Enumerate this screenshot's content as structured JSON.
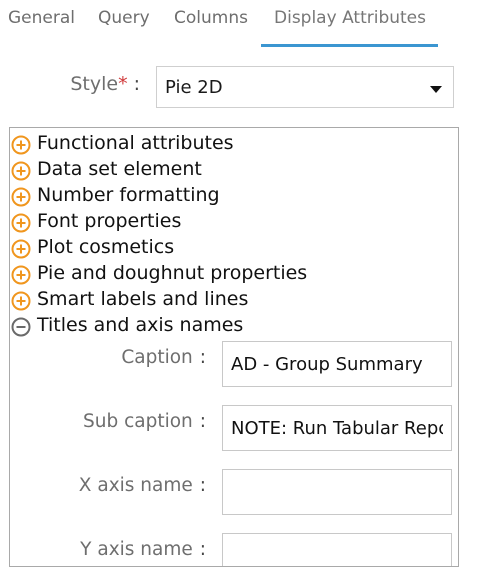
{
  "tabs": [
    {
      "label": "General"
    },
    {
      "label": "Query"
    },
    {
      "label": "Columns"
    },
    {
      "label": "Display Attributes",
      "active": true
    }
  ],
  "style": {
    "label": "Style",
    "required_mark": "*",
    "colon": ":",
    "selected": "Pie 2D"
  },
  "sections": [
    {
      "label": "Functional attributes",
      "state": "collapsed",
      "icon": "plus-circle-icon"
    },
    {
      "label": "Data set element",
      "state": "collapsed",
      "icon": "plus-circle-icon"
    },
    {
      "label": "Number formatting",
      "state": "collapsed",
      "icon": "plus-circle-icon"
    },
    {
      "label": "Font properties",
      "state": "collapsed",
      "icon": "plus-circle-icon"
    },
    {
      "label": "Plot cosmetics",
      "state": "collapsed",
      "icon": "plus-circle-icon"
    },
    {
      "label": "Pie and doughnut properties",
      "state": "collapsed",
      "icon": "plus-circle-icon"
    },
    {
      "label": "Smart labels and lines",
      "state": "collapsed",
      "icon": "plus-circle-icon"
    },
    {
      "label": "Titles and axis names",
      "state": "expanded",
      "icon": "minus-circle-icon"
    }
  ],
  "titles_fields": [
    {
      "label": "Caption",
      "colon": ":",
      "value": "AD - Group Summary"
    },
    {
      "label": "Sub caption",
      "colon": ":",
      "value": "NOTE: Run Tabular Report"
    },
    {
      "label": "X axis name",
      "colon": ":",
      "value": ""
    },
    {
      "label": "Y axis name",
      "colon": ":",
      "value": ""
    }
  ],
  "colors": {
    "accent": "#3b96d1",
    "expand_icon": "#f0961e",
    "collapse_icon": "#6a6a6a",
    "required": "#d0393a"
  }
}
